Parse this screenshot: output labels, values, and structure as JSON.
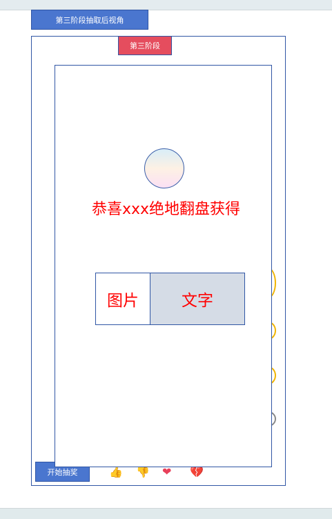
{
  "header": {
    "view_button": "第三阶段抽取后视角"
  },
  "stage": {
    "label": "第三阶段"
  },
  "result": {
    "message": "恭喜xxx绝地翻盘获得",
    "card_image": "图片",
    "card_text": "文字"
  },
  "footer": {
    "start_button": "开始抽奖",
    "icons": [
      "thumbs-up-icon",
      "thumbs-down-icon",
      "heart-icon",
      "broken-heart-icon"
    ]
  },
  "colors": {
    "primary": "#4a76cf",
    "stage": "#e54d5e",
    "text_red": "#ff0000"
  }
}
